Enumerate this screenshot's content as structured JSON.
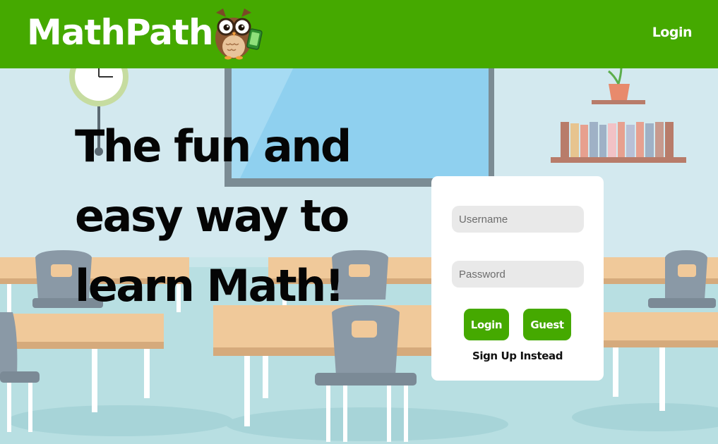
{
  "header": {
    "brand": "MathPath",
    "login_label": "Login",
    "color": "#45a900"
  },
  "hero": {
    "lines": [
      "The fun and",
      "easy way to",
      "learn Math!"
    ]
  },
  "login_form": {
    "username_placeholder": "Username",
    "password_placeholder": "Password",
    "login_label": "Login",
    "guest_label": "Guest",
    "signup_label": "Sign Up Instead"
  },
  "icons": {
    "logo": "owl-mascot-icon",
    "background": "classroom-illustration"
  }
}
